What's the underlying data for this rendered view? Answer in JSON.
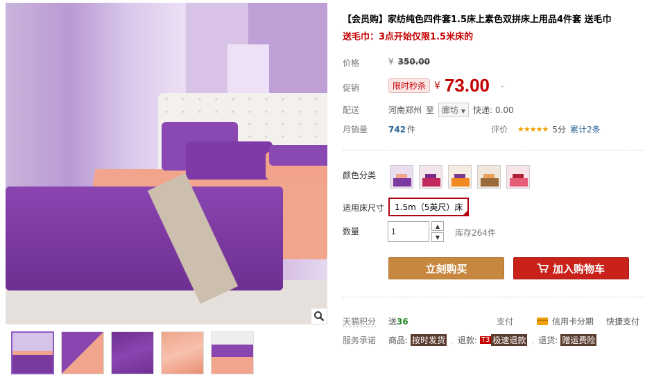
{
  "product": {
    "title": "【会员购】家纺纯色四件套1.5床上素色双拼床上用品4件套 送毛巾",
    "subtitle": "送毛巾：3点开始仅限1.5米床的"
  },
  "price": {
    "label": "价格",
    "currency": "¥",
    "original": "350.00"
  },
  "promo": {
    "label": "促销",
    "tag": "限时秒杀",
    "currency": "¥",
    "price": "73.00"
  },
  "shipping": {
    "label": "配送",
    "from": "河南郑州",
    "to_word": "至",
    "dest": "廊坊",
    "express": "快递: 0.00"
  },
  "sales": {
    "label": "月销量",
    "count": "742",
    "unit": "件",
    "rating_label": "评价",
    "stars": "★★★★★",
    "score": "5分",
    "reviews": "累计2条"
  },
  "color": {
    "label": "颜色分类",
    "options": [
      {
        "name": "purple",
        "bg": "#7b3aa0",
        "accent": "#f0a58c"
      },
      {
        "name": "red",
        "bg": "#c2285e",
        "accent": "#7b2a8a"
      },
      {
        "name": "orange",
        "bg": "#f08a20",
        "accent": "#7a3a8e"
      },
      {
        "name": "brown",
        "bg": "#9b6a3a",
        "accent": "#e9a15a"
      },
      {
        "name": "pink",
        "bg": "#e55b78",
        "accent": "#b02038"
      }
    ]
  },
  "size": {
    "label": "适用床尺寸",
    "selected": "1.5m（5英尺）床"
  },
  "quantity": {
    "label": "数量",
    "value": "1",
    "stock": "库存264件"
  },
  "buttons": {
    "buy": "立刻购买",
    "cart": "加入购物车"
  },
  "points": {
    "label": "天猫积分",
    "value_prefix": "送",
    "value": "36",
    "pay_label": "支付",
    "installment": "信用卡分期",
    "quick_pay": "快捷支付"
  },
  "service": {
    "label": "服务承诺",
    "goods_label": "商品:",
    "goods_tag": "按时发货",
    "refund_label": "退款:",
    "refund_badge": "T3",
    "refund_tag": "极速退款",
    "return_label": "退货:",
    "return_tag": "赠运费险"
  }
}
